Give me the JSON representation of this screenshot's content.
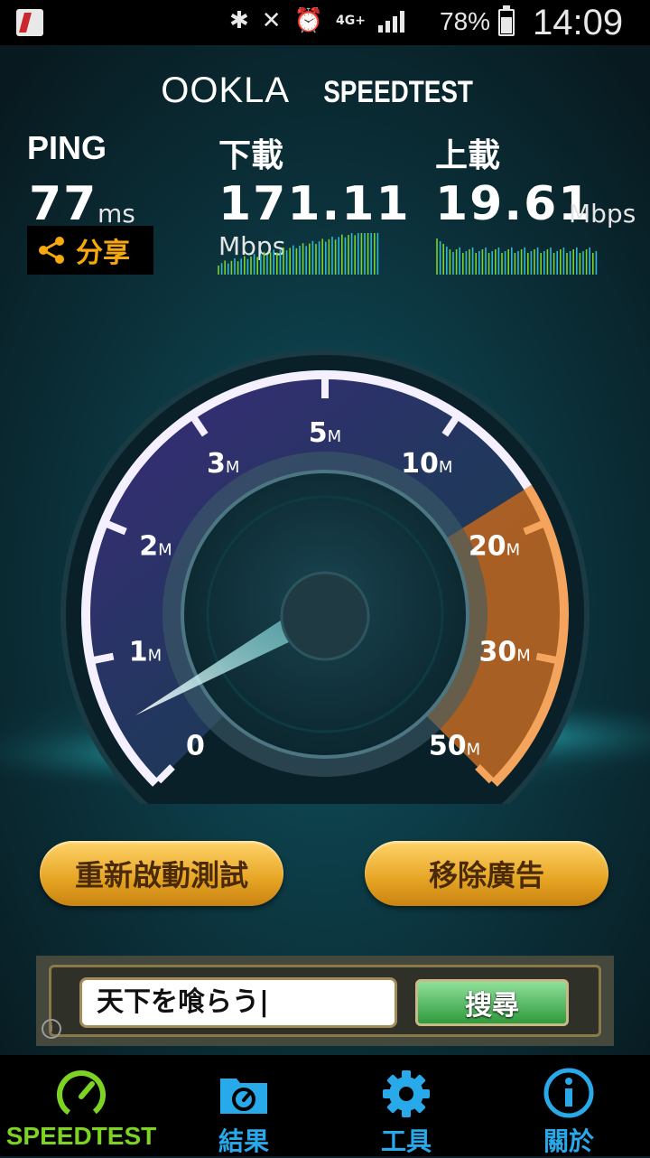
{
  "status_bar": {
    "battery": "78%",
    "time": "14:09",
    "network": "4G+"
  },
  "header": {
    "brand": "OOKLA",
    "product": "SPEEDTEST"
  },
  "metrics": {
    "ping": {
      "label": "PING",
      "value": "77",
      "unit": "ms"
    },
    "download": {
      "label": "下載",
      "value": "171.11",
      "unit": "Mbps"
    },
    "upload": {
      "label": "上載",
      "value": "19.61",
      "unit": "Mbps"
    }
  },
  "share": {
    "label": "分享"
  },
  "gauge": {
    "ticks": [
      {
        "label": "0",
        "unit": ""
      },
      {
        "label": "1",
        "unit": "M"
      },
      {
        "label": "2",
        "unit": "M"
      },
      {
        "label": "3",
        "unit": "M"
      },
      {
        "label": "5",
        "unit": "M"
      },
      {
        "label": "10",
        "unit": "M"
      },
      {
        "label": "20",
        "unit": "M"
      },
      {
        "label": "30",
        "unit": "M"
      },
      {
        "label": "50",
        "unit": "M"
      }
    ]
  },
  "buttons": {
    "restart": "重新啟動測試",
    "remove_ads": "移除廣告"
  },
  "ad": {
    "query": "天下を喰らう|",
    "search_label": "搜尋"
  },
  "bottom_nav": [
    {
      "label": "SPEEDTEST",
      "icon": "speedometer-icon",
      "active": true
    },
    {
      "label": "結果",
      "icon": "results-folder-icon",
      "active": false
    },
    {
      "label": "工具",
      "icon": "gear-icon",
      "active": false
    },
    {
      "label": "關於",
      "icon": "info-icon",
      "active": false
    }
  ],
  "colors": {
    "accent_green": "#7dd321",
    "accent_blue": "#28a9ea",
    "share_orange": "#f7a90c",
    "gauge_orange": "#e8832a",
    "gauge_purple": "#6a4fc0"
  }
}
